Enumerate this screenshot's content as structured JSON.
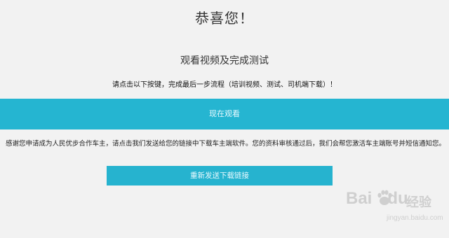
{
  "heading": {
    "title": "恭喜您！",
    "subtitle": "观看视频及完成测试",
    "instruction": "请点击以下按键，完成最后一步流程（培训视频、测试、司机端下载）！"
  },
  "actions": {
    "watch_now_label": "现在观看",
    "resend_link_label": "重新发送下载链接"
  },
  "body": {
    "thanks_text": "感谢您申请成为人民优步合作车主，请点击我们发送给您的链接中下载车主端软件。您的资料审核通过后，我们会帮您激活车主端账号并短信通知您。"
  },
  "watermark": {
    "brand_left": "Bai",
    "brand_right": "du",
    "jingyan": "经验",
    "url": "jingyan.baidu.com"
  },
  "colors": {
    "accent": "#25b5d1",
    "background": "#f2f2f2"
  }
}
